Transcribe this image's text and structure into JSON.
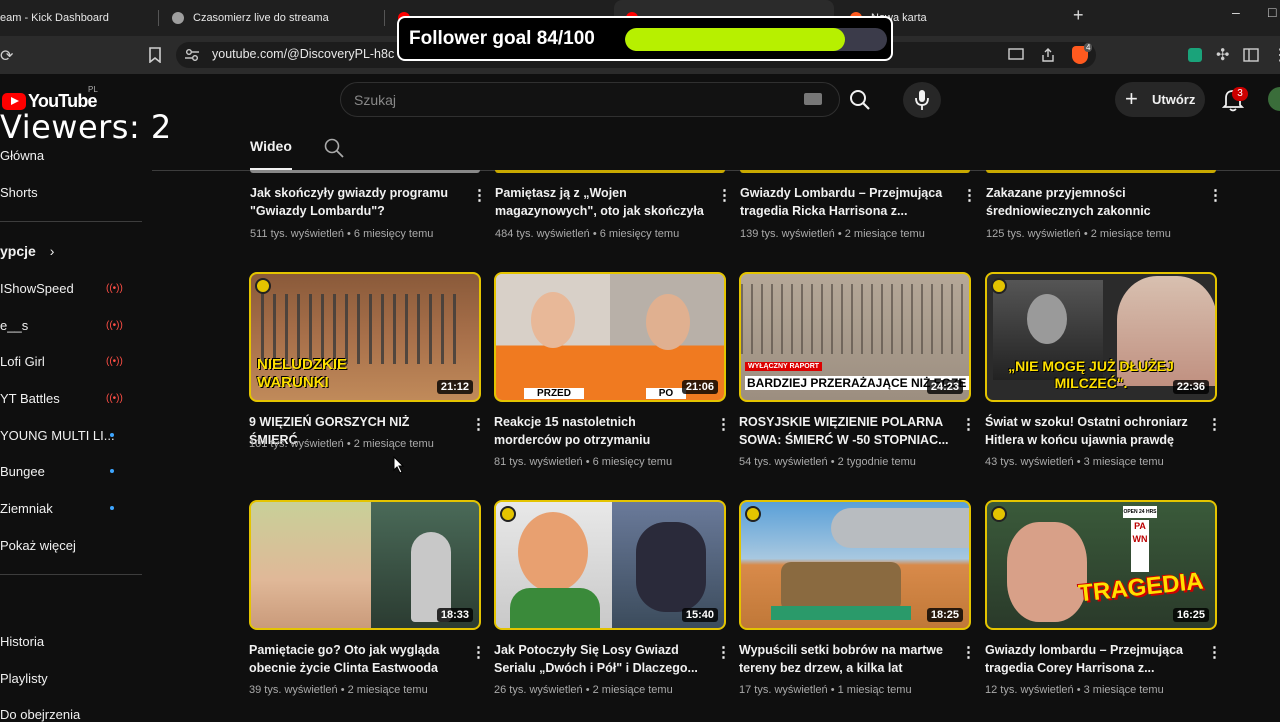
{
  "browser": {
    "tabs": [
      {
        "title": "eam - Kick Dashboard",
        "color": "#53fc18"
      },
      {
        "title": "Czasomierz live do streama",
        "color": "#9e9e9e"
      },
      {
        "title": "",
        "color": "#ff0000"
      },
      {
        "title": "",
        "color": "#ff0000"
      },
      {
        "title": "Nowa karta",
        "color": "#ff5a1f"
      }
    ],
    "new_tab": "+",
    "url": "youtube.com/@DiscoveryPL-h8c",
    "shield_count": "4"
  },
  "youtube": {
    "logo_word": "YouTube",
    "region": "PL",
    "search_placeholder": "Szukaj",
    "create_label": "Utwórz",
    "notif_count": "3"
  },
  "overlay": {
    "viewers_text": "Viewers: 2",
    "goal_label": "Follower goal 84/100",
    "goal_current": 84,
    "goal_target": 100,
    "goal_color": "#b7f000"
  },
  "channel_tabs": {
    "active": "Wideo"
  },
  "sidebar": {
    "top": [
      {
        "label": "Główna",
        "icon": "home-icon"
      },
      {
        "label": "Shorts",
        "icon": "shorts-icon"
      }
    ],
    "subs_heading": "ypcje",
    "subs": [
      {
        "label": "IShowSpeed",
        "live": true
      },
      {
        "label": "e__s",
        "live": true
      },
      {
        "label": "Lofi Girl",
        "live": true
      },
      {
        "label": "YT Battles",
        "live": true
      },
      {
        "label": "YOUNG MULTI LI...",
        "live": false
      },
      {
        "label": "Bungee",
        "live": false
      },
      {
        "label": "Ziemniak",
        "live": false
      },
      {
        "label": "Pokaż więcej",
        "live": null
      }
    ],
    "you": [
      {
        "label": "Historia"
      },
      {
        "label": "Playlisty"
      },
      {
        "label": "Do obejrzenia"
      }
    ]
  },
  "videos_top": [
    {
      "title": "Jak skończyły gwiazdy programu \"Gwiazdy Lombardu\"?",
      "meta": "511 tys. wyświetleń • 6 miesięcy temu"
    },
    {
      "title": "Pamiętasz ją z „Wojen magazynowych\", oto jak skończyła",
      "meta": "484 tys. wyświetleń • 6 miesięcy temu"
    },
    {
      "title": "Gwiazdy Lombardu – Przejmująca tragedia Ricka Harrisona z...",
      "meta": "139 tys. wyświetleń • 2 miesiące temu"
    },
    {
      "title": "Zakazane przyjemności średniowiecznych zakonnic",
      "meta": "125 tys. wyświetleń • 2 miesiące temu"
    }
  ],
  "videos_mid": [
    {
      "title": "9 WIĘZIEŃ GORSZYCH NIŻ ŚMIERĆ",
      "meta": "101 tys. wyświetleń • 2 miesiące temu",
      "duration": "21:12",
      "caption": "NIELUDZKIE WARUNKI"
    },
    {
      "title": "Reakcje 15 nastoletnich morderców po otrzymaniu wyroku...",
      "meta": "81 tys. wyświetleń • 6 miesięcy temu",
      "duration": "21:06",
      "caption_left": "PRZED",
      "caption_right": "PO"
    },
    {
      "title": "ROSYJSKIE WIĘZIENIE POLARNA SOWA: ŚMIERĆ W -50 STOPNIAC...",
      "meta": "54 tys. wyświetleń • 2 tygodnie temu",
      "duration": "24:23",
      "caption": "BARDZIEJ PRZERAŻAJĄCE NIŻ EGZE",
      "tag": "WYŁĄCZNY RAPORT"
    },
    {
      "title": "Świat w szoku! Ostatni ochroniarz Hitlera w końcu ujawnia prawdę o...",
      "meta": "43 tys. wyświetleń • 3 miesiące temu",
      "duration": "22:36",
      "caption": "„NIE MOGĘ JUŻ DŁUŻEJ MILCZEĆ\"."
    }
  ],
  "videos_bottom": [
    {
      "title": "Pamiętacie go? Oto jak wygląda obecnie życie Clinta Eastwooda",
      "meta": "39 tys. wyświetleń • 2 miesiące temu",
      "duration": "18:33"
    },
    {
      "title": "Jak Potoczyły Się Losy Gwiazd Serialu „Dwóch i Pół\" i Dlaczego...",
      "meta": "26 tys. wyświetleń • 2 miesiące temu",
      "duration": "15:40"
    },
    {
      "title": "Wypuścili setki bobrów na martwe tereny bez drzew, a kilka lat późnie...",
      "meta": "17 tys. wyświetleń • 1 miesiąc temu",
      "duration": "18:25"
    },
    {
      "title": "Gwiazdy lombardu – Przejmująca tragedia Corey Harrisona z...",
      "meta": "12 tys. wyświetleń • 3 miesiące temu",
      "duration": "16:25",
      "caption": "TRAGEDIA",
      "sign_top": "OPEN 24 HRS",
      "sign": "PAWN"
    }
  ]
}
